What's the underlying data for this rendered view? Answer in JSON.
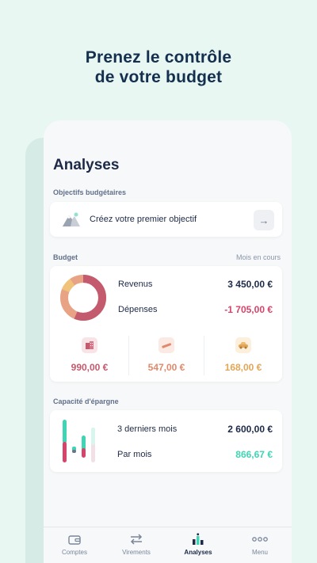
{
  "promo": {
    "line1": "Prenez le contrôle",
    "line2": "de votre budget"
  },
  "page": {
    "title": "Analyses"
  },
  "goals": {
    "section_label": "Objectifs budgétaires",
    "create_text": "Créez votre premier objectif",
    "icon": "mountain-icon",
    "action_icon": "arrow-right-icon"
  },
  "budget": {
    "section_label": "Budget",
    "period": "Mois en cours",
    "income_label": "Revenus",
    "income_value": "3 450,00 €",
    "expense_label": "Dépenses",
    "expense_value": "-1 705,00 €",
    "categories": [
      {
        "icon": "building-icon",
        "value": "990,00 €",
        "color": "#c45a6e"
      },
      {
        "icon": "pencil-icon",
        "value": "547,00 €",
        "color": "#e08a6c"
      },
      {
        "icon": "car-icon",
        "value": "168,00 €",
        "color": "#e3a657"
      }
    ]
  },
  "savings": {
    "section_label": "Capacité d'épargne",
    "last_months_label": "3 derniers mois",
    "last_months_value": "2 600,00 €",
    "per_month_label": "Par mois",
    "per_month_value": "866,67 €"
  },
  "tabbar": {
    "items": [
      {
        "label": "Comptes",
        "icon": "wallet-icon"
      },
      {
        "label": "Virements",
        "icon": "transfer-icon"
      },
      {
        "label": "Analyses",
        "icon": "chart-icon",
        "active": true
      },
      {
        "label": "Menu",
        "icon": "dots-icon"
      }
    ]
  },
  "colors": {
    "accent_teal": "#3fd4b4",
    "negative": "#d6446a",
    "navy": "#1d2a47"
  }
}
